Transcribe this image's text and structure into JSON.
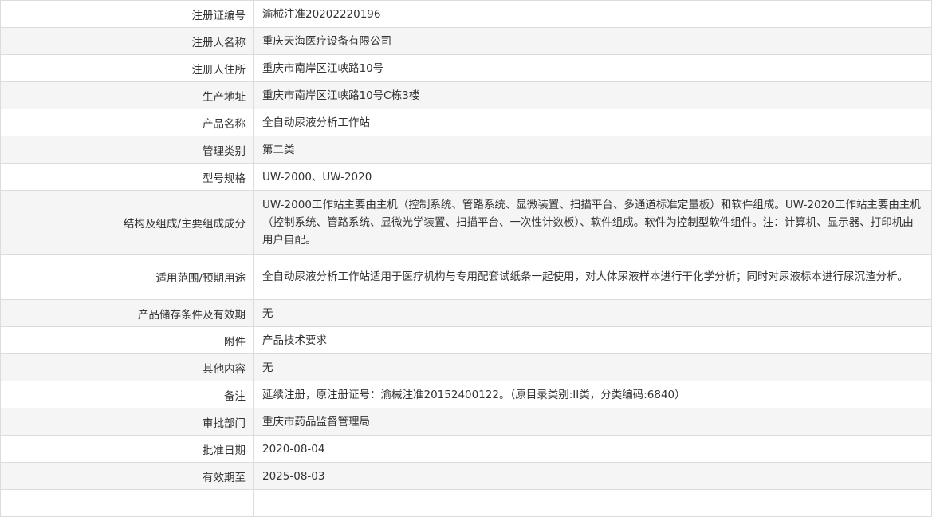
{
  "rows": [
    {
      "label": "注册证编号",
      "value": "渝械注准20202220196"
    },
    {
      "label": "注册人名称",
      "value": "重庆天海医疗设备有限公司"
    },
    {
      "label": "注册人住所",
      "value": "重庆市南岸区江峡路10号"
    },
    {
      "label": "生产地址",
      "value": "重庆市南岸区江峡路10号C栋3楼"
    },
    {
      "label": "产品名称",
      "value": "全自动尿液分析工作站"
    },
    {
      "label": "管理类别",
      "value": "第二类"
    },
    {
      "label": "型号规格",
      "value": "UW-2000、UW-2020"
    },
    {
      "label": "结构及组成/主要组成成分",
      "value": "UW-2000工作站主要由主机（控制系统、管路系统、显微装置、扫描平台、多通道标准定量板）和软件组成。UW-2020工作站主要由主机（控制系统、管路系统、显微光学装置、扫描平台、一次性计数板）、软件组成。软件为控制型软件组件。注：计算机、显示器、打印机由用户自配。"
    },
    {
      "label": "适用范围/预期用途",
      "value": "全自动尿液分析工作站适用于医疗机构与专用配套试纸条一起使用，对人体尿液样本进行干化学分析；同时对尿液标本进行尿沉渣分析。"
    },
    {
      "label": "产品储存条件及有效期",
      "value": "无"
    },
    {
      "label": "附件",
      "value": "产品技术要求"
    },
    {
      "label": "其他内容",
      "value": "无"
    },
    {
      "label": "备注",
      "value": "延续注册，原注册证号：渝械注准20152400122。（原目录类别:II类，分类编码:6840）"
    },
    {
      "label": "审批部门",
      "value": "重庆市药品监督管理局"
    },
    {
      "label": "批准日期",
      "value": "2020-08-04"
    },
    {
      "label": "有效期至",
      "value": "2025-08-03"
    },
    {
      "label": "",
      "value": ""
    }
  ]
}
